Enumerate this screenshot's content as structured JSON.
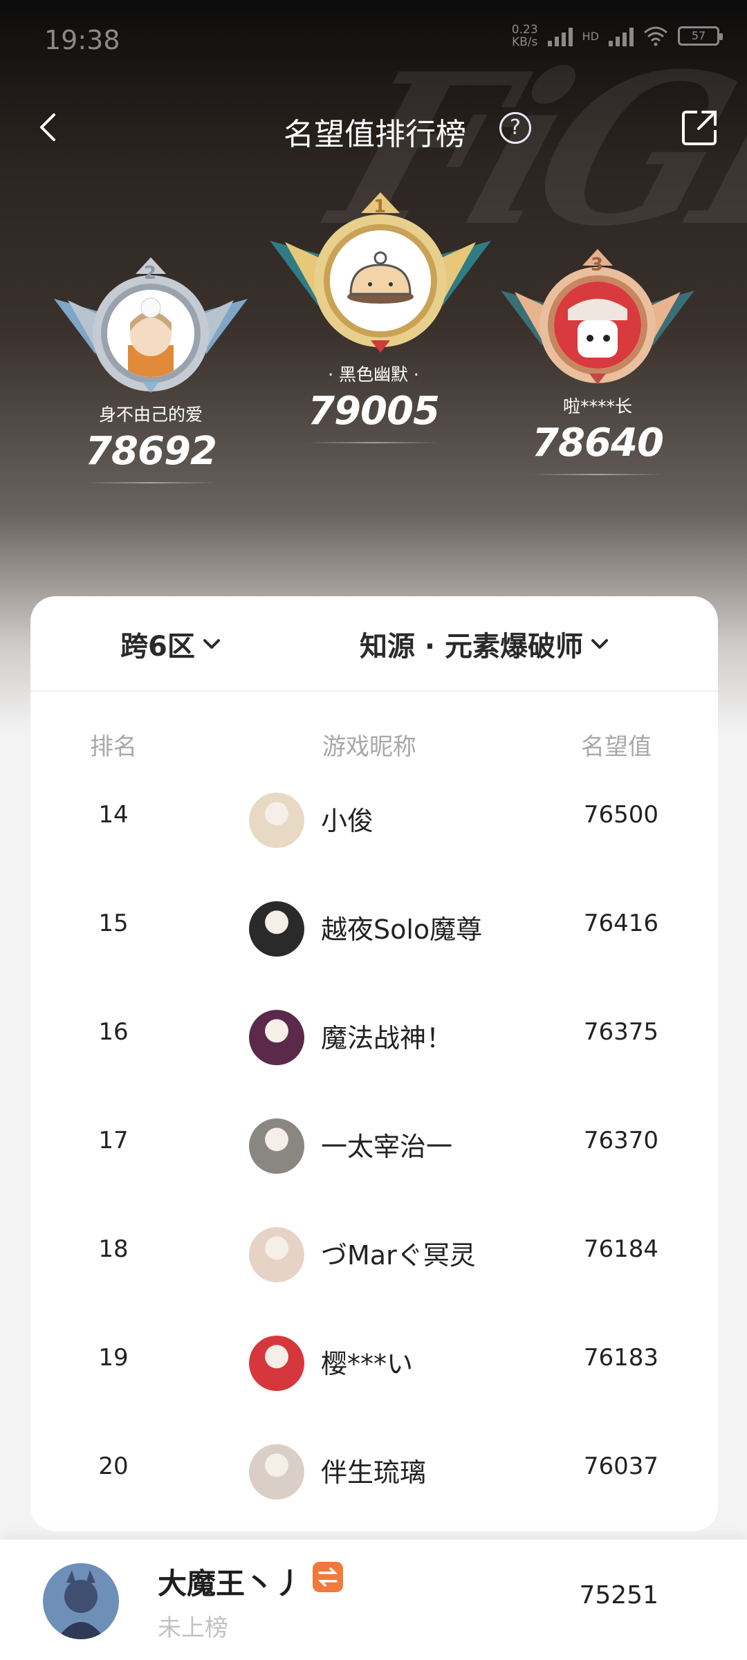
{
  "status_bar": {
    "time": "19:38",
    "speed_value": "0.23",
    "speed_unit": "KB/s",
    "net_label": "HD",
    "battery": "57"
  },
  "header": {
    "title": "名望值排行榜",
    "help_label": "?"
  },
  "podium": [
    {
      "rank": "2",
      "name": "身不由己的爱",
      "score": "78692",
      "avatar_icon": "cat-anime-avatar-icon"
    },
    {
      "rank": "1",
      "name": "· 黑色幽默 ·",
      "score": "79005",
      "avatar_icon": "bun-character-avatar-icon"
    },
    {
      "rank": "3",
      "name": "啦****长",
      "score": "78640",
      "avatar_icon": "red-character-avatar-icon"
    }
  ],
  "filters": {
    "server": "跨6区",
    "job": "知源 · 元素爆破师"
  },
  "columns": {
    "rank": "排名",
    "nickname": "游戏昵称",
    "score": "名望值"
  },
  "rows": [
    {
      "rank": "14",
      "name": "小俊",
      "score": "76500",
      "avatar_color": "#e8d9c4"
    },
    {
      "rank": "15",
      "name": "越夜Solo魔尊",
      "score": "76416",
      "avatar_color": "#2a2a2a"
    },
    {
      "rank": "16",
      "name": "魔法战神！",
      "score": "76375",
      "avatar_color": "#5b2a4a"
    },
    {
      "rank": "17",
      "name": "一太宰治一",
      "score": "76370",
      "avatar_color": "#8a8680"
    },
    {
      "rank": "18",
      "name": "づMarぐ冥灵",
      "score": "76184",
      "avatar_color": "#e7d3c6"
    },
    {
      "rank": "19",
      "name": "樱***い",
      "score": "76183",
      "avatar_color": "#d6373c"
    },
    {
      "rank": "20",
      "name": "伴生琉璃",
      "score": "76037",
      "avatar_color": "#d9cfc6"
    }
  ],
  "my_entry": {
    "name": "大魔王丶丿",
    "status": "未上榜",
    "score": "75251"
  }
}
